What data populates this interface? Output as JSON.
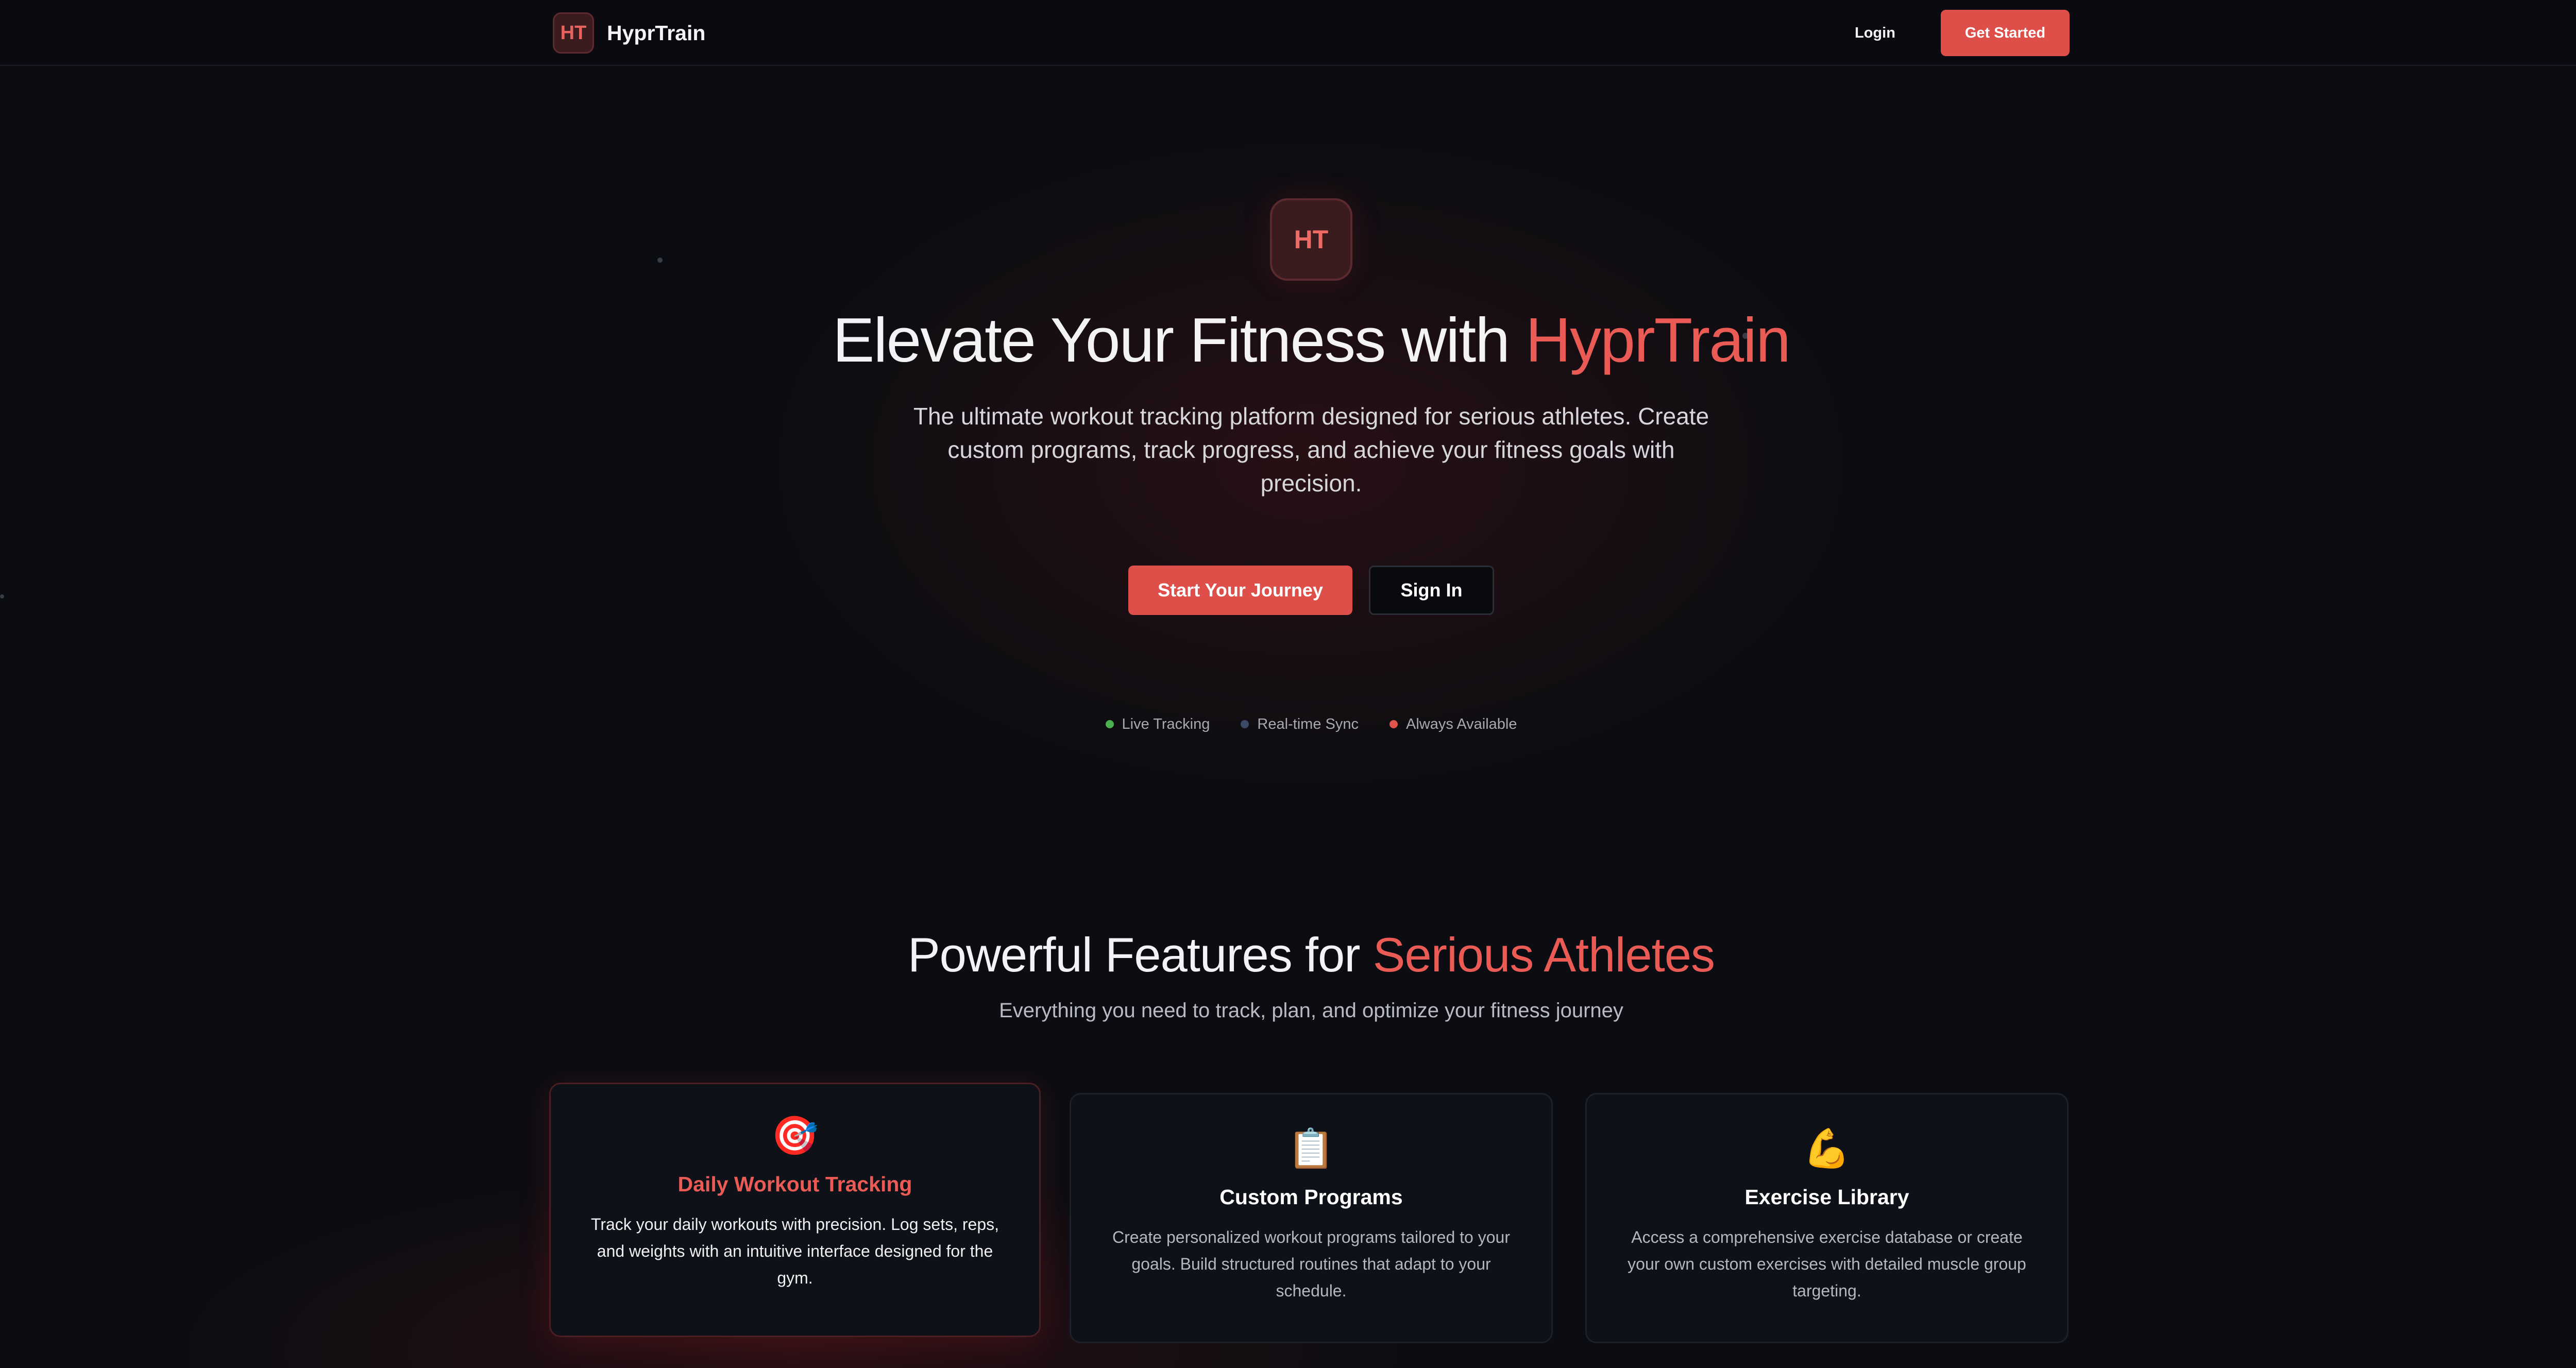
{
  "nav": {
    "brand_badge": "HT",
    "brand_name": "HyprTrain",
    "login": "Login",
    "cta": "Get Started"
  },
  "hero": {
    "logo": "HT",
    "title_prefix": "Elevate Your Fitness with ",
    "title_accent": "HyprTrain",
    "subtitle": "The ultimate workout tracking platform designed for serious athletes. Create custom programs, track progress, and achieve your fitness goals with precision.",
    "primary_button": "Start Your Journey",
    "secondary_button": "Sign In",
    "status": [
      {
        "label": "Live Tracking",
        "color": "#4caf50"
      },
      {
        "label": "Real-time Sync",
        "color": "#3a4a66"
      },
      {
        "label": "Always Available",
        "color": "#e0524c"
      }
    ]
  },
  "features": {
    "title_prefix": "Powerful Features for ",
    "title_accent": "Serious Athletes",
    "subtitle": "Everything you need to track, plan, and optimize your fitness journey",
    "cards": [
      {
        "icon": "🎯",
        "icon_name": "target-icon",
        "title": "Daily Workout Tracking",
        "description": "Track your daily workouts with precision. Log sets, reps, and weights with an intuitive interface designed for the gym."
      },
      {
        "icon": "📋",
        "icon_name": "clipboard-icon",
        "title": "Custom Programs",
        "description": "Create personalized workout programs tailored to your goals. Build structured routines that adapt to your schedule."
      },
      {
        "icon": "💪",
        "icon_name": "flexed-biceps-icon",
        "title": "Exercise Library",
        "description": "Access a comprehensive exercise database or create your own custom exercises with detailed muscle group targeting."
      }
    ]
  },
  "colors": {
    "accent": "#e0524c",
    "background": "#0c0d12",
    "card_background": "#0f1118"
  }
}
